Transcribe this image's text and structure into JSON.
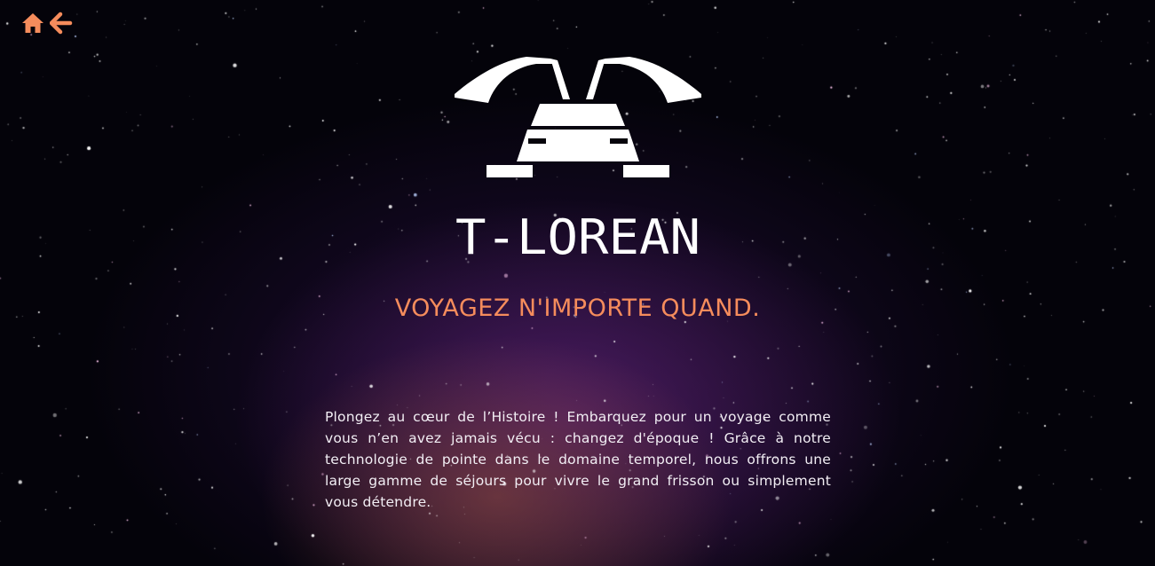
{
  "nav": {
    "home_icon": "home-icon",
    "back_icon": "arrow-left-icon",
    "accent_color": "#f58c5c"
  },
  "logo": {
    "icon": "delorean-car-icon",
    "color": "#ffffff"
  },
  "brand": {
    "name": "T-LOREAN"
  },
  "hero": {
    "tagline": "VOYAGEZ N'IMPORTE QUAND.",
    "tagline_color": "#f58c5c",
    "intro": "Plongez au cœur de l’Histoire ! Embarquez pour un voyage comme vous n’en avez jamais vécu : changez d'époque ! Grâce à notre technologie de pointe dans le domaine temporel, nous offrons une large gamme de séjours pour vivre le grand frisson ou simplement vous détendre."
  }
}
